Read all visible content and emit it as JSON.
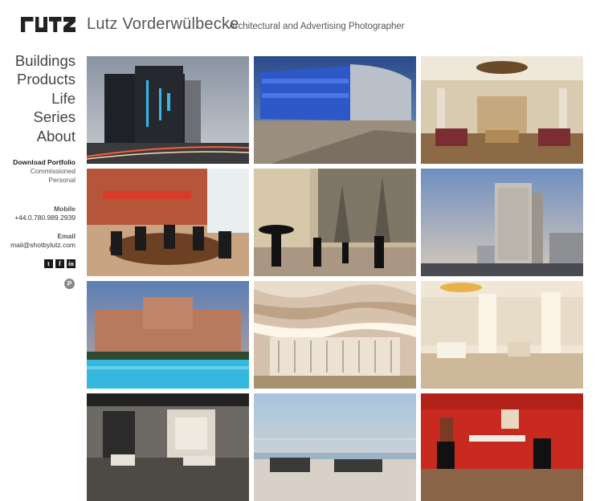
{
  "header": {
    "title": "Lutz Vorderwülbecke",
    "tagline": "Architectural and Advertising Photographer"
  },
  "nav": {
    "items": [
      {
        "label": "Buildings",
        "name": "nav-buildings"
      },
      {
        "label": "Products",
        "name": "nav-products"
      },
      {
        "label": "Life",
        "name": "nav-life"
      },
      {
        "label": "Series",
        "name": "nav-series"
      },
      {
        "label": "About",
        "name": "nav-about"
      }
    ]
  },
  "portfolio": {
    "heading": "Download Portfolio",
    "links": [
      "Commissioned",
      "Personal"
    ]
  },
  "contact": {
    "mobile_label": "Mobile",
    "mobile": "+44.0.780.989.2939",
    "email_label": "Email",
    "email": "mail@shotbylutz.com"
  },
  "social": {
    "twitter": "t",
    "facebook": "f",
    "linkedin": "in",
    "pinterest": "P"
  },
  "photos": [
    {
      "name": "photo-night-tower-hotel"
    },
    {
      "name": "photo-curved-facade-building"
    },
    {
      "name": "photo-hotel-lobby-chandelier"
    },
    {
      "name": "photo-conference-room"
    },
    {
      "name": "photo-cathedral-terrace"
    },
    {
      "name": "photo-high-rise-hotel-dusk"
    },
    {
      "name": "photo-resort-pool"
    },
    {
      "name": "photo-wavy-balconies"
    },
    {
      "name": "photo-hotel-lobby-columns"
    },
    {
      "name": "photo-lounge-interior"
    },
    {
      "name": "photo-sea-terrace"
    },
    {
      "name": "photo-red-dining-room"
    }
  ]
}
